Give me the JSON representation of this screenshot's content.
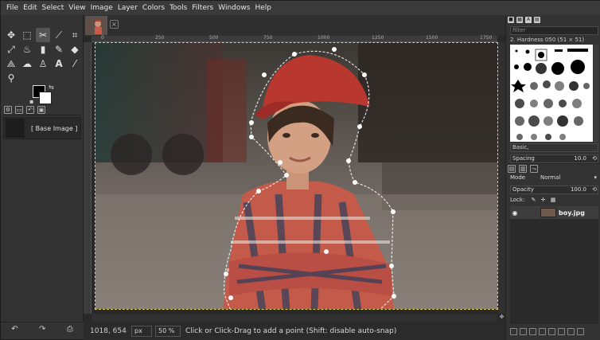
{
  "menubar": {
    "items": [
      "File",
      "Edit",
      "Select",
      "View",
      "Image",
      "Layer",
      "Colors",
      "Tools",
      "Filters",
      "Windows",
      "Help"
    ]
  },
  "tabstrip": {
    "image_tab_icon": "image-thumbnail",
    "close_icon": "close-icon"
  },
  "toolbox": {
    "tools": [
      {
        "name": "move-tool-icon",
        "glyph": "✥"
      },
      {
        "name": "rect-select-tool-icon",
        "glyph": "⬚"
      },
      {
        "name": "scissors-select-tool-icon",
        "glyph": "✂"
      },
      {
        "name": "fuzzy-select-tool-icon",
        "glyph": "⟋"
      },
      {
        "name": "crop-tool-icon",
        "glyph": "⌗"
      },
      {
        "name": "transform-tool-icon",
        "glyph": "⤢"
      },
      {
        "name": "warp-tool-icon",
        "glyph": "♨"
      },
      {
        "name": "clone-tool-icon",
        "glyph": "▮"
      },
      {
        "name": "paint-tool-icon",
        "glyph": "✎"
      },
      {
        "name": "eraser-tool-icon",
        "glyph": "◆"
      },
      {
        "name": "path-tool-icon",
        "glyph": "⟁"
      },
      {
        "name": "smudge-tool-icon",
        "glyph": "☁"
      },
      {
        "name": "dodge-tool-icon",
        "glyph": "♙"
      },
      {
        "name": "text-tool-icon",
        "glyph": "A"
      },
      {
        "name": "eyedropper-tool-icon",
        "glyph": "⁄"
      },
      {
        "name": "zoom-tool-icon",
        "glyph": "⚲"
      }
    ],
    "active_tool": "scissors-select-tool-icon",
    "base_image_label": "[ Base Image ]",
    "bottom_buttons": [
      "↶",
      "↷",
      "⎙"
    ]
  },
  "canvas": {
    "ruler_ticks": [
      "0",
      "250",
      "500",
      "750",
      "1000",
      "1250",
      "1500",
      "1750"
    ],
    "photo_description_icon": "boy-photo"
  },
  "statusbar": {
    "coords": "1018, 654",
    "unit": "px",
    "zoom": "50 %",
    "message": "Click or Click-Drag to add a point (Shift: disable auto-snap)"
  },
  "rdock": {
    "filter_placeholder": "filter",
    "brush_name": "2. Hardness 050 (51 × 51)",
    "brush_tag": "Basic,",
    "spacing_label": "Spacing",
    "spacing_value": "10.0",
    "mode_label": "Mode",
    "mode_value": "Normal",
    "opacity_label": "Opacity",
    "opacity_value": "100.0",
    "lock_label": "Lock:",
    "layer_name": "boy.jpg"
  },
  "colors": {
    "selection_outline": "#e8d24a",
    "scissors_points": "#ffffff",
    "accent": "#e8d24a"
  }
}
